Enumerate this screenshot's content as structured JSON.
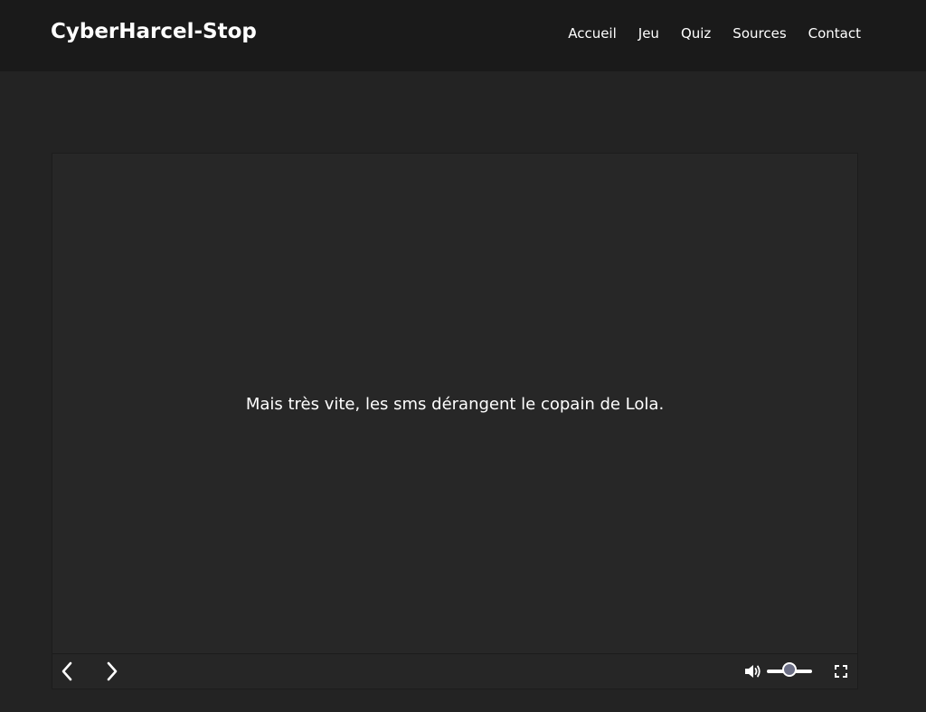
{
  "header": {
    "brand": "CyberHarcel-Stop",
    "nav": [
      {
        "label": "Accueil"
      },
      {
        "label": "Jeu"
      },
      {
        "label": "Quiz"
      },
      {
        "label": "Sources"
      },
      {
        "label": "Contact"
      }
    ]
  },
  "player": {
    "caption": "Mais très vite, les sms dérangent le copain de Lola.",
    "controls": {
      "prev_icon": "chevron-left-icon",
      "next_icon": "chevron-right-icon",
      "volume_icon": "speaker-icon",
      "fullscreen_icon": "fullscreen-icon",
      "volume_level": 0.5
    }
  },
  "colors": {
    "page_background": "#232323",
    "header_background": "#1a1a1a",
    "player_background": "#272727",
    "slider_thumb": "#6c6f86"
  }
}
